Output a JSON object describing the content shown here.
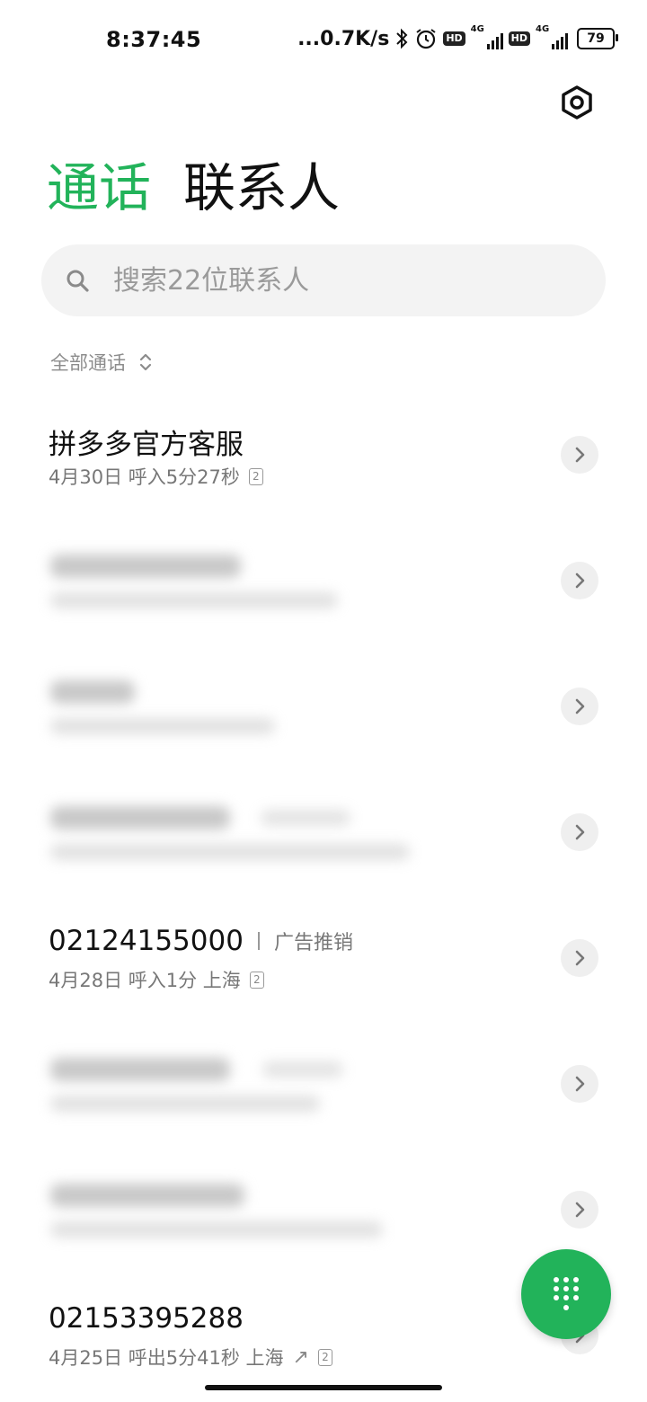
{
  "status_bar": {
    "time": "8:37:45",
    "network_speed": "...0.7K/s",
    "hd_label": "HD",
    "signal_label": "4G",
    "battery": "79"
  },
  "icons": {
    "settings": "settings-hex-icon",
    "search": "search-icon",
    "filter": "chevron-updown-icon",
    "row": "chevron-right-icon",
    "dialpad": "dialpad-icon"
  },
  "colors": {
    "accent": "#22b35a"
  },
  "tabs": [
    {
      "label": "通话",
      "active": true
    },
    {
      "label": "联系人",
      "active": false
    }
  ],
  "search": {
    "placeholder": "搜索22位联系人"
  },
  "filter": {
    "label": "全部通话"
  },
  "calls": [
    {
      "name": "拼多多官方客服",
      "detail": "4月30日 呼入5分27秒",
      "sim": "2",
      "blurred": false
    },
    {
      "blurred": true
    },
    {
      "blurred": true
    },
    {
      "blurred": true
    },
    {
      "name": "02124155000",
      "tag": "广告推销",
      "detail": "4月28日 呼入1分 上海",
      "sim": "2",
      "blurred": false
    },
    {
      "blurred": true
    },
    {
      "blurred": true
    },
    {
      "name": "02153395288",
      "detail": "4月25日 呼出5分41秒 上海",
      "direction_symbol": "↗",
      "sim": "2",
      "blurred": false
    }
  ]
}
